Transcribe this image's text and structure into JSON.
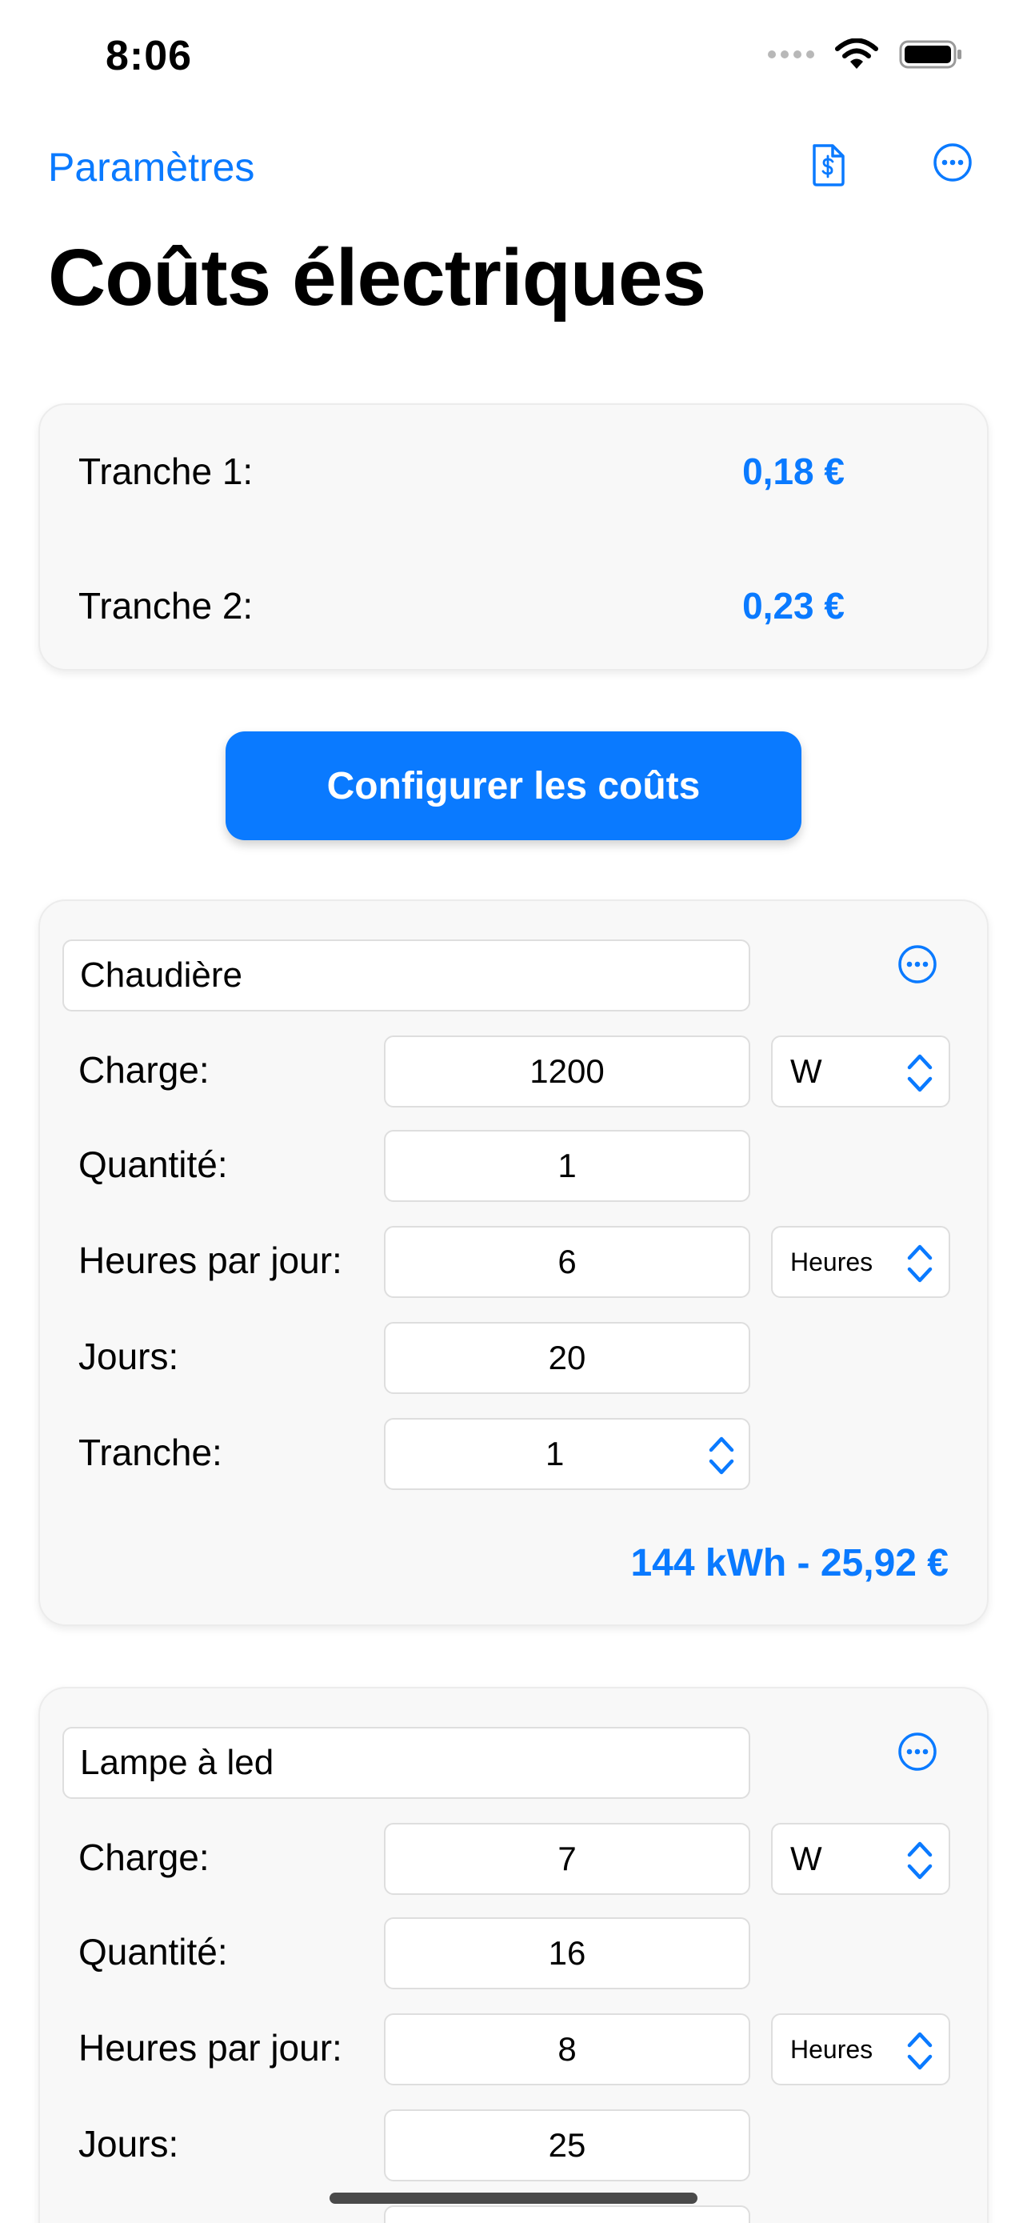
{
  "status_bar": {
    "time": "8:06"
  },
  "nav": {
    "back_label": "Paramètres"
  },
  "page": {
    "title": "Coûts électriques"
  },
  "tiers": [
    {
      "label": "Tranche 1:",
      "value": "0,18 €"
    },
    {
      "label": "Tranche 2:",
      "value": "0,23 €"
    }
  ],
  "config_button": {
    "label": "Configurer les coûts"
  },
  "appliances": [
    {
      "name": "Chaudière",
      "load_label": "Charge:",
      "load_value": "1200",
      "load_unit": "W",
      "quantity_label": "Quantité:",
      "quantity_value": "1",
      "hours_label": "Heures par jour:",
      "hours_value": "6",
      "hours_unit": "Heures",
      "days_label": "Jours:",
      "days_value": "20",
      "tier_label": "Tranche:",
      "tier_value": "1",
      "total": "144 kWh - 25,92 €"
    },
    {
      "name": "Lampe à led",
      "load_label": "Charge:",
      "load_value": "7",
      "load_unit": "W",
      "quantity_label": "Quantité:",
      "quantity_value": "16",
      "hours_label": "Heures par jour:",
      "hours_value": "8",
      "hours_unit": "Heures",
      "days_label": "Jours:",
      "days_value": "25"
    }
  ],
  "icons": {
    "nav_doc": "dollar-document-icon",
    "nav_more": "ellipsis-circle-icon",
    "card_more": "ellipsis-circle-icon",
    "picker": "chevron-up-down-icon",
    "wifi": "wifi-icon",
    "battery": "battery-icon"
  },
  "colors": {
    "accent": "#0a7aff",
    "card_bg": "#f8f8f8",
    "field_border": "#dedede"
  }
}
